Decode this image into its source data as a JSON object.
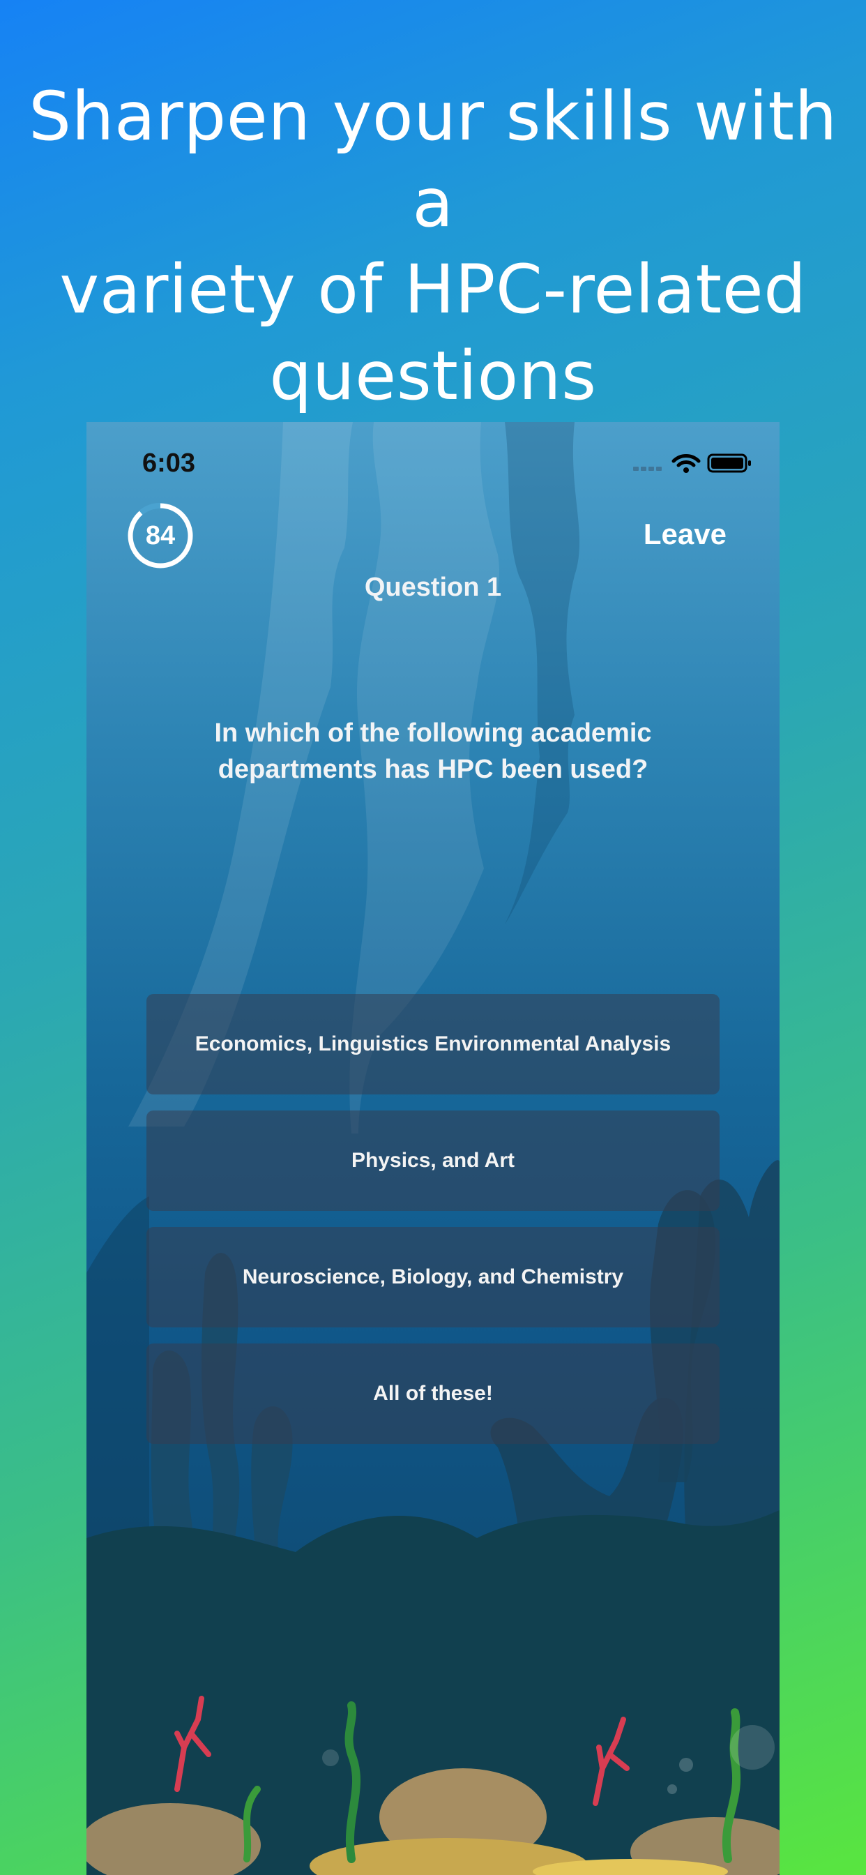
{
  "promo": {
    "headline_line1": "Sharpen your skills with a",
    "headline_line2": "variety of HPC-related",
    "headline_line3": "questions"
  },
  "status_bar": {
    "time": "6:03",
    "icons": [
      "signal-icon",
      "wifi-icon",
      "battery-icon"
    ]
  },
  "quiz": {
    "timer_value": "84",
    "leave_label": "Leave",
    "question_label": "Question 1",
    "question_line1": "In which of the following academic",
    "question_line2": "departments has HPC been used?",
    "answers": [
      "Economics, Linguistics Environmental Analysis",
      "Physics, and Art",
      "Neuroscience, Biology, and Chemistry",
      "All of these!"
    ]
  },
  "colors": {
    "background_top": "#1682f5",
    "background_bottom": "#59e53f",
    "answer_button": "#353e52"
  }
}
